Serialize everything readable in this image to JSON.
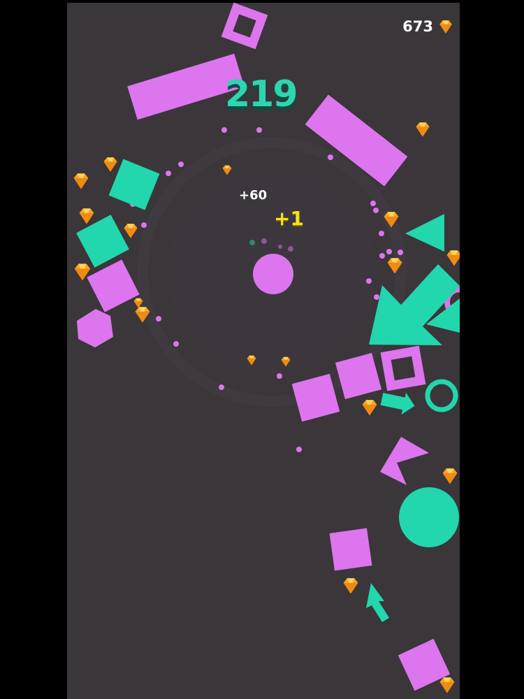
{
  "hud": {
    "gem_count": "673",
    "gem_icon": "diamond-gem-icon"
  },
  "score": {
    "value": "219"
  },
  "popups": {
    "bonus_white": "+60",
    "bonus_yellow": "+1"
  },
  "colors": {
    "background": "#3a363a",
    "letterbox": "#000000",
    "pink": "#dd75ee",
    "teal": "#22d6ad",
    "score_teal": "#2ed6b0",
    "gem_orange": "#f6a623",
    "popup_yellow": "#f6e21c"
  }
}
